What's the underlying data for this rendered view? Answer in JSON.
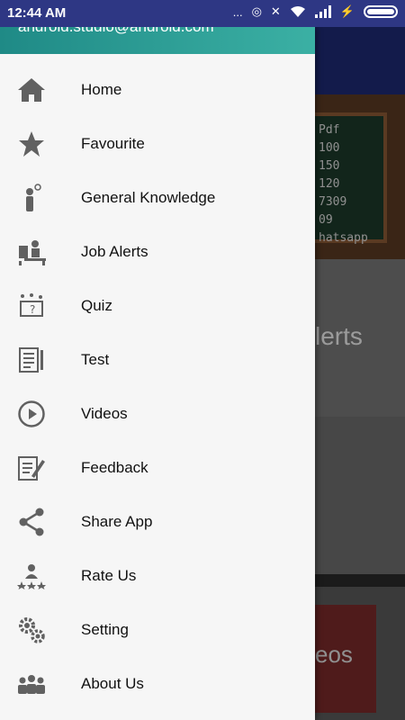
{
  "status_bar": {
    "time": "12:44 AM",
    "dots": "...",
    "charging": "⚡"
  },
  "drawer": {
    "email": "android.studio@android.com",
    "items": [
      {
        "label": "Home",
        "icon": "home-icon"
      },
      {
        "label": "Favourite",
        "icon": "star-icon"
      },
      {
        "label": "General Knowledge",
        "icon": "thinking-person-icon"
      },
      {
        "label": "Job Alerts",
        "icon": "desk-worker-icon"
      },
      {
        "label": "Quiz",
        "icon": "quiz-icon"
      },
      {
        "label": "Test",
        "icon": "test-sheet-icon"
      },
      {
        "label": "Videos",
        "icon": "play-circle-icon"
      },
      {
        "label": "Feedback",
        "icon": "feedback-icon"
      },
      {
        "label": "Share App",
        "icon": "share-icon"
      },
      {
        "label": "Rate Us",
        "icon": "rate-icon"
      },
      {
        "label": "Setting",
        "icon": "gears-icon"
      },
      {
        "label": "About Us",
        "icon": "group-icon"
      }
    ]
  },
  "background": {
    "board_lines": [
      "Pdf",
      "100",
      "150",
      "120",
      "7309",
      "09",
      "hatsapp"
    ],
    "card_alerts_text": "lerts",
    "card_videos_text": "eos"
  }
}
